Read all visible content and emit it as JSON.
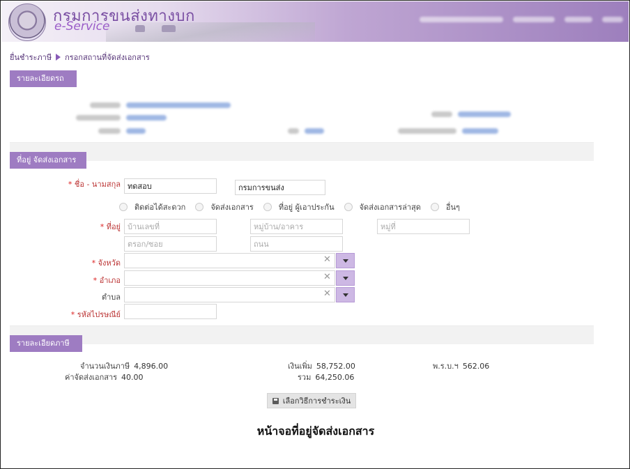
{
  "header": {
    "brand_thai": "กรมการขนส่งทางบก",
    "brand_en": "e-Service"
  },
  "breadcrumb": {
    "step1": "ยื่นชำระภาษี",
    "step2": "กรอกสถานที่จัดส่งเอกสาร"
  },
  "sections": {
    "vehicle_details": "รายละเอียดรถ",
    "delivery_address": "ที่อยู่ จัดส่งเอกสาร",
    "tax_details": "รายละเอียดภาษี"
  },
  "form": {
    "name_label": "ชื่อ - นามสกุล",
    "first_name": "ทดสอบ",
    "last_name": "กรมการขนส่ง",
    "address_options": [
      "ติดต่อได้สะดวก",
      "จัดส่งเอกสาร",
      "ที่อยู่ ผู้เอาประกัน",
      "จัดส่งเอกสารล่าสุด",
      "อื่นๆ"
    ],
    "address_label": "ที่อยู่",
    "house_no_placeholder": "บ้านเลขที่",
    "village_placeholder": "หมู่บ้าน/อาคาร",
    "moo_placeholder": "หมู่ที่",
    "soi_placeholder": "ตรอก/ซอย",
    "road_placeholder": "ถนน",
    "province_label": "จังหวัด",
    "district_label": "อำเภอ",
    "subdistrict_label": "ตำบล",
    "postcode_label": "รหัสไปรษณีย์",
    "required_mark": "*",
    "clear_glyph": "✕"
  },
  "tax": {
    "tax_amount_label": "จำนวนเงินภาษี",
    "tax_amount": "4,896.00",
    "surcharge_label": "เงินเพิ่ม",
    "surcharge": "58,752.00",
    "act_label": "พ.ร.บ.ฯ",
    "act": "562.06",
    "delivery_fee_label": "ค่าจัดส่งเอกสาร",
    "delivery_fee": "40.00",
    "total_label": "รวม",
    "total": "64,250.06"
  },
  "actions": {
    "pay_button": "เลือกวิธีการชำระเงิน"
  },
  "caption": "หน้าจอที่อยู่จัดส่งเอกสาร",
  "colors": {
    "accent": "#9e7cc2",
    "brand_text": "#7a4fa3"
  }
}
